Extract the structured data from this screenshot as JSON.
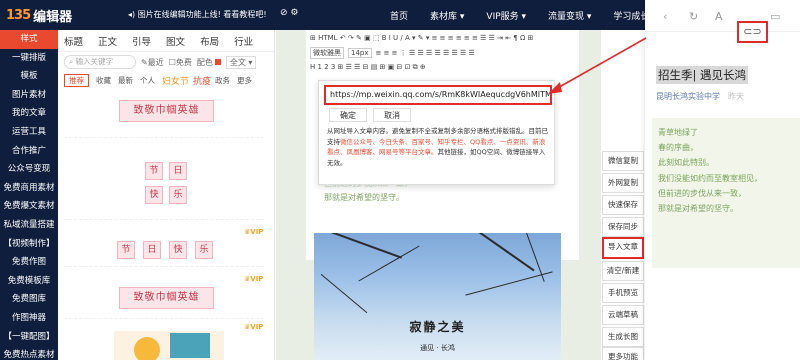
{
  "app": {
    "logo_mark": "135",
    "logo_text": "编辑器",
    "notice": "图片在线编辑功能上线! 看看教程吧!",
    "notice_icons": "⊘ ⚙"
  },
  "nav": [
    "首页",
    "素材库 ▾",
    "VIP服务 ▾",
    "流量变现 ▾",
    "学习成长 ▾"
  ],
  "sidebar": [
    "样式",
    "一键排版",
    "模板",
    "图片素材",
    "我的文章",
    "运营工具",
    "合作推广",
    "公众号变现",
    "免费商用素材",
    "免费爆文素材",
    "私域流量搭建",
    "【视频制作】",
    "免费作图",
    "免费模板库",
    "免费图库",
    "作图神器",
    "【一键配图】",
    "免费热点素材"
  ],
  "tpl": {
    "tabs": [
      "标题",
      "正文",
      "引导",
      "图文",
      "布局",
      "行业"
    ],
    "search_placeholder": "输入关键字",
    "opt_recent": "最近",
    "opt_free": "免费",
    "color_label": "配色",
    "full_label": "全文 ▾",
    "filters": [
      "推荐",
      "收藏",
      "最新",
      "个人"
    ],
    "festival_1": "妇女节",
    "festival_2": "抗疫",
    "filter_more_1": "政务",
    "filter_more_2": "更多",
    "honor": "致敬巾帼英雄",
    "chars_2x2": [
      "节",
      "日",
      "快",
      "乐"
    ],
    "chars_row": [
      "节",
      "日",
      "快",
      "乐"
    ],
    "vip": "VIP"
  },
  "toolbar": {
    "row1": "⊞ HTML ↶ ↷ ✎ ▣ ⬚ B I U ∕ A ▾ ✎ ▾ ≡ ≡ ≡ ≡ ≡ ≡ ☰ ☰ ⇥ ⇤ ¶ Ω ⊞",
    "font": "微软雅黑",
    "size": "14px",
    "row2": "≡ ≡ ≡ ⋮ ☰ ☰ ☰ ☰ ☰ ☰ ☰ ☰",
    "row3": "H 1 2 3 ⊞ ☰ ☰ ⊟ ▤ ⊞ ▣ ⊟ ⊡ ⧉ ⊕"
  },
  "dialog": {
    "url_value": "https://mp.weixin.qq.com/s/RmK8kWIAequcdgV6hMITMw",
    "confirm": "确定",
    "cancel": "取消",
    "text_1": "从网址导入文章内容。避免复制不全或复制多余部分语格式排版错乱。目前已支持",
    "text_hl": "微信公众号、今日头条、百家号、知乎专栏、QQ看点、一点资讯、新浪看点、凤凰博客、网易号等平台文章。",
    "text_2": "其他链接，如QQ空间、微博链接导入无效。"
  },
  "editor": {
    "green_line_1": "但前进的步伐从来一致，",
    "green_line_2": "那就是对希望的坚守。",
    "photo_title": "寂静之美",
    "photo_sub": "通见 · 长鸿"
  },
  "functions": [
    "微信复制",
    "外网复制",
    "快速保存",
    "保存同步",
    "导入文章",
    "清空/新建",
    "手机预览",
    "云端草稿",
    "生成长图",
    "更多功能"
  ],
  "article": {
    "nav_icons": [
      "‹",
      "↻",
      "A",
      "⊂⊃",
      "▭"
    ],
    "title": "招生季| 遇见长鸿",
    "account": "昆明长鸿实验中学",
    "time": "昨天",
    "lines": [
      "青草地绿了",
      "春的序曲，",
      "此刻如此特别。",
      "我们没能如约而至教室相见，",
      "但前进的步伐从来一致，",
      "那就是对希望的坚守。"
    ]
  },
  "colors": {
    "dark_nav": "#0f1e3d",
    "accent": "#e94a2f",
    "highlight_red": "#e02b2b",
    "green_text": "#7ba35d"
  }
}
